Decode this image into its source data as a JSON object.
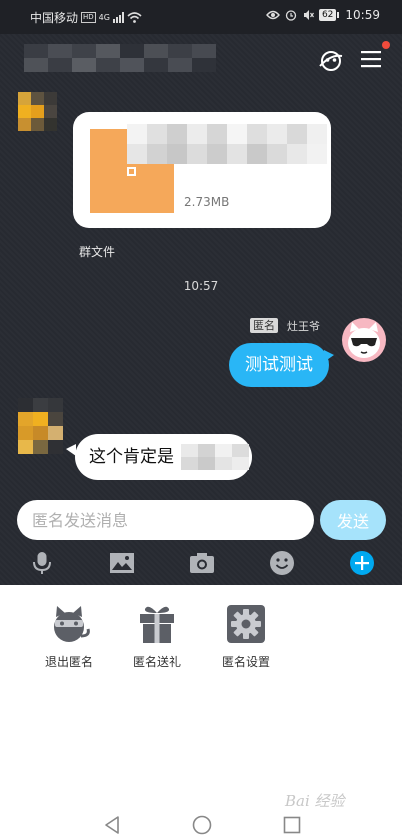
{
  "status_bar": {
    "carrier": "中国移动",
    "hd": "HD",
    "network": "4G",
    "battery": "62",
    "time": "10:59"
  },
  "header": {
    "chat_title": "",
    "icons": [
      "anonymous-mask-icon",
      "menu-icon"
    ]
  },
  "messages": {
    "file": {
      "size": "2.73MB",
      "caption": "群文件"
    },
    "timestamp": "10:57",
    "mine": {
      "anonymous_tag": "匿名",
      "sender_name": "灶王爷",
      "text": "测试测试"
    },
    "other": {
      "text": "这个肯定是"
    }
  },
  "composer": {
    "placeholder": "匿名发送消息",
    "send_label": "发送"
  },
  "toolbar": {
    "icons": [
      "microphone-icon",
      "image-icon",
      "camera-icon",
      "emoji-icon",
      "plus-icon"
    ],
    "active_color": "#00a9f0"
  },
  "panel": {
    "items": [
      {
        "label": "退出匿名",
        "icon": "anonymous-cat-icon"
      },
      {
        "label": "匿名送礼",
        "icon": "gift-icon"
      },
      {
        "label": "匿名设置",
        "icon": "settings-gear-icon"
      }
    ]
  },
  "watermark": "Bai 经验"
}
